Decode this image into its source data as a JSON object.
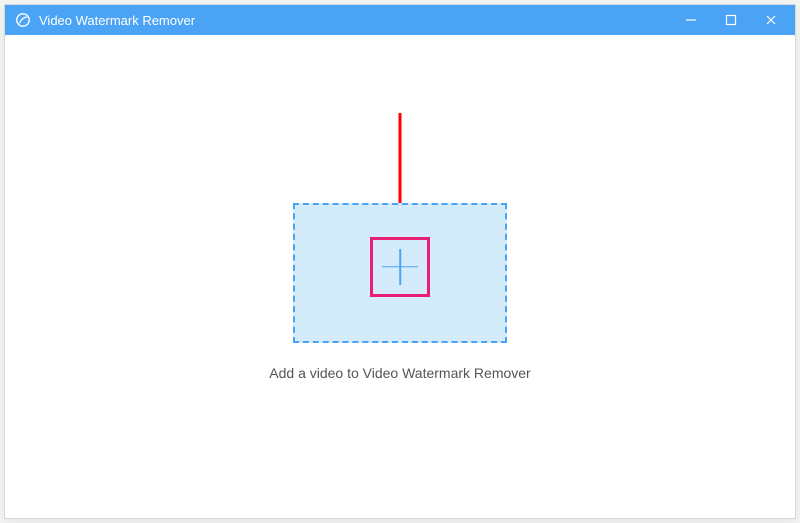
{
  "titlebar": {
    "app_title": "Video Watermark Remover"
  },
  "main": {
    "dropzone_label": "Add a video to Video Watermark Remover"
  },
  "colors": {
    "accent": "#4aa3f5",
    "dropzone_bg": "#d4ebfc",
    "highlight_box": "#e91e75",
    "annotation_arrow": "#ff0000"
  }
}
